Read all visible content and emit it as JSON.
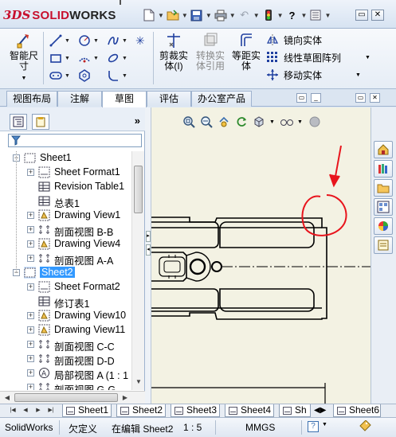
{
  "app": {
    "brand_prefix": "3DS",
    "brand_name_lead": "SOLID",
    "brand_name_tail": "WORKS"
  },
  "quick_access": {
    "icons": [
      "new-document-icon",
      "open-folder-icon",
      "save-icon",
      "print-icon",
      "undo-icon",
      "rebuild-icon",
      "help-icon",
      "options-icon"
    ],
    "help_label": "?"
  },
  "ribbon": {
    "smart_dimension": {
      "label_line1": "智能尺",
      "label_line2": "寸"
    },
    "trim_entities": {
      "label_line1": "剪裁实",
      "label_line2": "体(I)"
    },
    "convert_entities": {
      "label_line1": "转换实",
      "label_line2": "体引用"
    },
    "offset_entities": {
      "label_line1": "等距实",
      "label_line2": "体"
    },
    "mirror_entities": {
      "label": "镜向实体"
    },
    "linear_pattern": {
      "label": "线性草图阵列"
    },
    "move_entities": {
      "label": "移动实体"
    }
  },
  "tabs": [
    {
      "label": "视图布局",
      "active": false
    },
    {
      "label": "注解",
      "active": false
    },
    {
      "label": "草图",
      "active": true
    },
    {
      "label": "评估",
      "active": false
    },
    {
      "label": "办公室产品",
      "active": false
    }
  ],
  "feature_tree": {
    "chevron": "»",
    "items": [
      {
        "label": "Sheet1",
        "level": 0,
        "expander": "−",
        "icon": "sheet-icon",
        "selected": false
      },
      {
        "label": "Sheet Format1",
        "level": 1,
        "expander": "+",
        "icon": "sheet-format-icon",
        "selected": false
      },
      {
        "label": "Revision Table1",
        "level": 1,
        "expander": "",
        "icon": "table-icon",
        "selected": false
      },
      {
        "label": "总表1",
        "level": 1,
        "expander": "",
        "icon": "table-icon",
        "selected": false
      },
      {
        "label": "Drawing View1",
        "level": 1,
        "expander": "+",
        "icon": "drawing-view-icon",
        "selected": false
      },
      {
        "label": "剖面视图 B-B",
        "level": 1,
        "expander": "+",
        "icon": "section-view-icon",
        "selected": false
      },
      {
        "label": "Drawing View4",
        "level": 1,
        "expander": "+",
        "icon": "drawing-view-icon",
        "selected": false
      },
      {
        "label": "剖面视图 A-A",
        "level": 1,
        "expander": "+",
        "icon": "section-view-icon",
        "selected": false
      },
      {
        "label": "Sheet2",
        "level": 0,
        "expander": "−",
        "icon": "sheet-icon",
        "selected": true
      },
      {
        "label": "Sheet Format2",
        "level": 1,
        "expander": "+",
        "icon": "sheet-format-icon",
        "selected": false
      },
      {
        "label": "修订表1",
        "level": 1,
        "expander": "",
        "icon": "table-icon",
        "selected": false
      },
      {
        "label": "Drawing View10",
        "level": 1,
        "expander": "+",
        "icon": "drawing-view-icon",
        "selected": false
      },
      {
        "label": "Drawing View11",
        "level": 1,
        "expander": "+",
        "icon": "drawing-view-icon",
        "selected": false
      },
      {
        "label": "剖面视图 C-C",
        "level": 1,
        "expander": "+",
        "icon": "section-view-icon",
        "selected": false
      },
      {
        "label": "剖面视图 D-D",
        "level": 1,
        "expander": "+",
        "icon": "section-view-icon",
        "selected": false
      },
      {
        "label": "局部视图 A (1 : 1",
        "level": 1,
        "expander": "+",
        "icon": "detail-view-icon",
        "selected": false
      },
      {
        "label": "剖面视图 G-G",
        "level": 1,
        "expander": "+",
        "icon": "section-view-icon",
        "selected": false
      }
    ]
  },
  "sheet_tabs": [
    {
      "label": "Sheet1",
      "active": false
    },
    {
      "label": "Sheet2",
      "active": true
    },
    {
      "label": "Sheet3",
      "active": false
    },
    {
      "label": "Sheet4",
      "active": false
    },
    {
      "label": "Sh",
      "active": false
    },
    {
      "label": "Sheet6",
      "active": false
    }
  ],
  "status": {
    "app_name": "SolidWorks",
    "definition_state": "欠定义",
    "editing": "在编辑 Sheet2",
    "scale": "1 : 5",
    "units": "MMGS",
    "help": "?"
  },
  "colors": {
    "selection": "#3399ff",
    "annotation_red": "#e8141c",
    "canvas_bg": "#f3f2e3",
    "brand_red": "#c8102e"
  }
}
